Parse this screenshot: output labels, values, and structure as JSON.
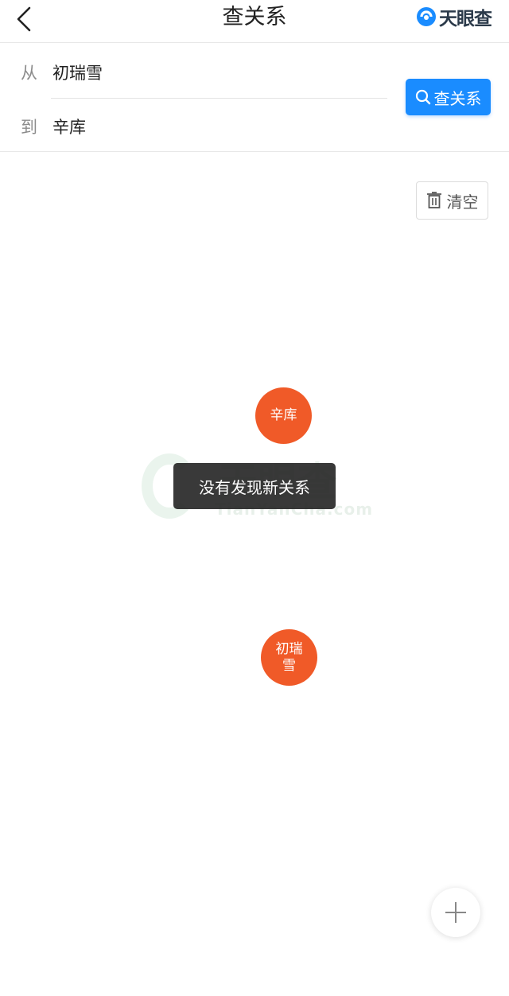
{
  "header": {
    "title": "查关系",
    "back_icon": "chevron-left-icon",
    "brand_logo_icon": "tianyancha-logo-icon",
    "brand_name": "天眼查",
    "brand_color": "#1a8cff"
  },
  "form": {
    "from_label": "从",
    "from_value": "初瑞雪",
    "to_label": "到",
    "to_value": "辛库",
    "search_button_label": "查关系",
    "search_icon": "search-icon",
    "accent_color": "#1a8cff"
  },
  "toolbar": {
    "clear_label": "清空",
    "clear_icon": "trash-icon"
  },
  "graph": {
    "node_color": "#f05a28",
    "nodes": [
      {
        "label": "辛库"
      },
      {
        "label": "初瑞雪"
      }
    ],
    "watermark": {
      "text": "天眼查",
      "subtext": "TianYanCha.com"
    }
  },
  "toast": {
    "message": "没有发现新关系"
  },
  "fab": {
    "icon": "plus-icon"
  }
}
